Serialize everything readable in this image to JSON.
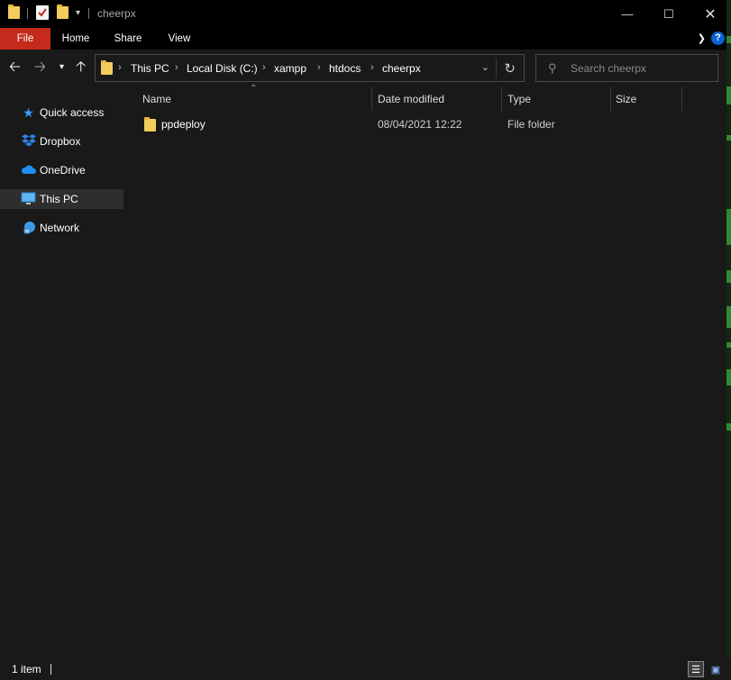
{
  "title_bar": {
    "window_title": "cheerpx",
    "quick_access_icons": [
      "folder-icon",
      "properties-icon",
      "new-folder-icon",
      "customize-qat-icon"
    ],
    "controls": [
      "minimize-icon",
      "maximize-icon",
      "close-icon"
    ]
  },
  "ribbon": {
    "tabs": [
      {
        "label": "File",
        "active": true
      },
      {
        "label": "Home"
      },
      {
        "label": "Share"
      },
      {
        "label": "View"
      }
    ],
    "help_label": "?"
  },
  "navigation": {
    "buttons": [
      "back-icon",
      "forward-icon",
      "recent-locations-icon",
      "up-icon"
    ],
    "breadcrumb": [
      "This PC",
      "Local Disk (C:)",
      "xampp",
      "htdocs",
      "cheerpx"
    ],
    "search_placeholder": "Search cheerpx"
  },
  "sidebar": {
    "items": [
      {
        "label": "Quick access",
        "icon": "star-icon",
        "selected": false
      },
      {
        "label": "Dropbox",
        "icon": "dropbox-icon",
        "selected": false
      },
      {
        "label": "OneDrive",
        "icon": "cloud-icon",
        "selected": false
      },
      {
        "label": "This PC",
        "icon": "computer-icon",
        "selected": true
      },
      {
        "label": "Network",
        "icon": "network-icon",
        "selected": false
      }
    ]
  },
  "file_list": {
    "columns": [
      "Name",
      "Date modified",
      "Type",
      "Size"
    ],
    "sort_column": "Name",
    "rows": [
      {
        "name": "ppdeploy",
        "date_modified": "08/04/2021 12:22",
        "type": "File folder",
        "size": "",
        "icon": "folder-icon"
      }
    ]
  },
  "status_bar": {
    "item_count": "1 item",
    "views": [
      "details-view-icon",
      "large-icons-view-icon"
    ]
  },
  "colors": {
    "background": "#191919",
    "titlebar": "#000000",
    "file_tab": "#c42b1c",
    "folder": "#f3cd5c",
    "accent": "#0a62d0"
  }
}
